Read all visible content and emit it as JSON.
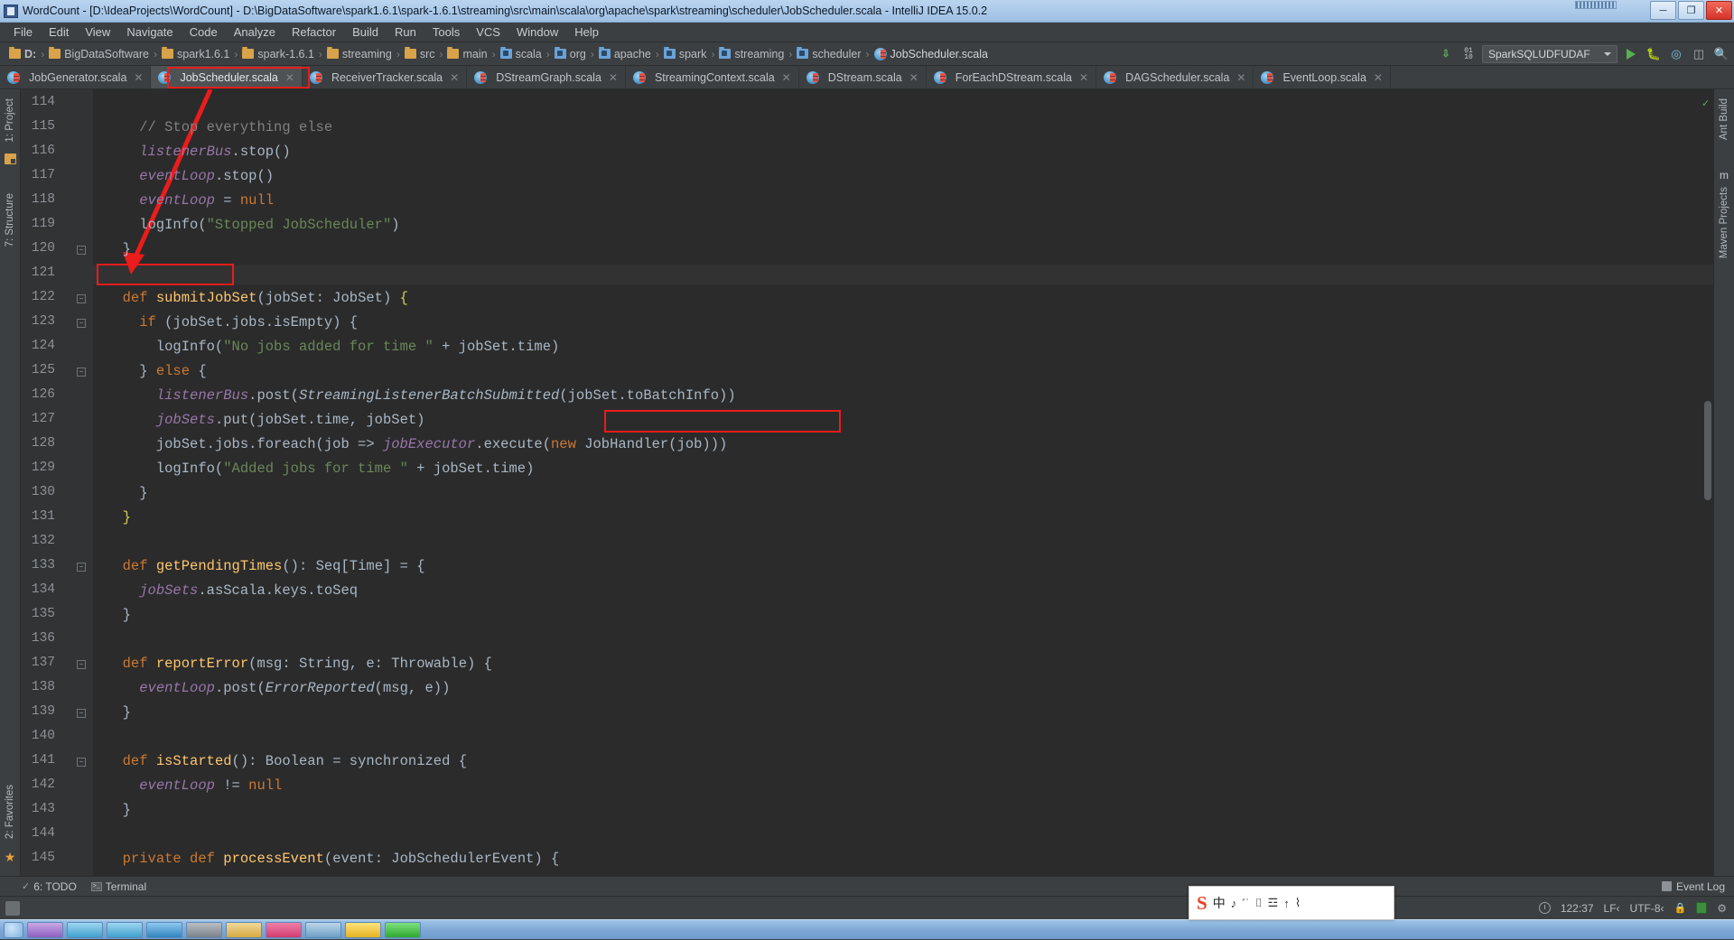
{
  "window": {
    "title": "WordCount - [D:\\IdeaProjects\\WordCount] - D:\\BigDataSoftware\\spark1.6.1\\spark-1.6.1\\streaming\\src\\main\\scala\\org\\apache\\spark\\streaming\\scheduler\\JobScheduler.scala - IntelliJ IDEA 15.0.2",
    "minimize": "─",
    "maximize": "❐",
    "close": "✕"
  },
  "menubar": {
    "items": [
      "File",
      "Edit",
      "View",
      "Navigate",
      "Code",
      "Analyze",
      "Refactor",
      "Build",
      "Run",
      "Tools",
      "VCS",
      "Window",
      "Help"
    ]
  },
  "breadcrumb": {
    "items": [
      {
        "label": "D:",
        "icon": "folder-icon",
        "type": "folder"
      },
      {
        "label": "BigDataSoftware",
        "icon": "folder-icon",
        "type": "folder"
      },
      {
        "label": "spark1.6.1",
        "icon": "folder-icon",
        "type": "folder"
      },
      {
        "label": "spark-1.6.1",
        "icon": "folder-icon",
        "type": "folder"
      },
      {
        "label": "streaming",
        "icon": "folder-icon",
        "type": "folder"
      },
      {
        "label": "src",
        "icon": "folder-icon",
        "type": "folder"
      },
      {
        "label": "main",
        "icon": "folder-icon",
        "type": "folder"
      },
      {
        "label": "scala",
        "icon": "package-icon",
        "type": "package"
      },
      {
        "label": "org",
        "icon": "package-icon",
        "type": "package"
      },
      {
        "label": "apache",
        "icon": "package-icon",
        "type": "package"
      },
      {
        "label": "spark",
        "icon": "package-icon",
        "type": "package"
      },
      {
        "label": "streaming",
        "icon": "package-icon",
        "type": "package"
      },
      {
        "label": "scheduler",
        "icon": "package-icon",
        "type": "package"
      },
      {
        "label": "JobScheduler.scala",
        "icon": "scala-file-icon",
        "type": "scala"
      }
    ]
  },
  "toolbar": {
    "run_config": "SparkSQLUDFUDAF",
    "sort_icon": "sort-descending-icon",
    "binary_icon": "binary-toggle-icon",
    "run_icon": "run-icon",
    "debug_icon": "debug-icon",
    "coverage_icon": "coverage-icon",
    "layout_icon": "layout-icon",
    "search_icon": "search-icon"
  },
  "editor_tabs": [
    {
      "label": "JobGenerator.scala",
      "selected": false,
      "close": "✕"
    },
    {
      "label": "JobScheduler.scala",
      "selected": true,
      "close": "✕"
    },
    {
      "label": "ReceiverTracker.scala",
      "selected": false,
      "close": "✕"
    },
    {
      "label": "DStreamGraph.scala",
      "selected": false,
      "close": "✕"
    },
    {
      "label": "StreamingContext.scala",
      "selected": false,
      "close": "✕"
    },
    {
      "label": "DStream.scala",
      "selected": false,
      "close": "✕"
    },
    {
      "label": "ForEachDStream.scala",
      "selected": false,
      "close": "✕"
    },
    {
      "label": "DAGScheduler.scala",
      "selected": false,
      "close": "✕"
    },
    {
      "label": "EventLoop.scala",
      "selected": false,
      "close": "✕"
    }
  ],
  "left_sidebar": {
    "items": [
      {
        "label": "1: Project",
        "icon": "project-icon"
      },
      {
        "label": "7: Structure",
        "icon": "structure-icon"
      },
      {
        "label": "2: Favorites",
        "icon": "favorites-star-icon"
      }
    ]
  },
  "right_sidebar": {
    "items": [
      {
        "label": "Ant Build",
        "icon": "ant-icon"
      },
      {
        "label": "Maven Projects",
        "icon": "maven-icon"
      }
    ]
  },
  "code": {
    "first_line": 114,
    "lines": [
      {
        "n": 114,
        "fold": "",
        "tokens": []
      },
      {
        "n": 115,
        "fold": "",
        "tokens": [
          {
            "t": "    ",
            "c": "plain"
          },
          {
            "t": "// Stop everything else",
            "c": "cmt"
          }
        ]
      },
      {
        "n": 116,
        "fold": "",
        "tokens": [
          {
            "t": "    ",
            "c": "plain"
          },
          {
            "t": "listenerBus",
            "c": "fld"
          },
          {
            "t": ".stop()",
            "c": "plain"
          }
        ]
      },
      {
        "n": 117,
        "fold": "",
        "tokens": [
          {
            "t": "    ",
            "c": "plain"
          },
          {
            "t": "eventLoop",
            "c": "fld"
          },
          {
            "t": ".stop()",
            "c": "plain"
          }
        ]
      },
      {
        "n": 118,
        "fold": "",
        "tokens": [
          {
            "t": "    ",
            "c": "plain"
          },
          {
            "t": "eventLoop",
            "c": "fld"
          },
          {
            "t": " = ",
            "c": "plain"
          },
          {
            "t": "null",
            "c": "kw"
          }
        ]
      },
      {
        "n": 119,
        "fold": "",
        "tokens": [
          {
            "t": "    logInfo(",
            "c": "plain"
          },
          {
            "t": "\"Stopped JobScheduler\"",
            "c": "str"
          },
          {
            "t": ")",
            "c": "plain"
          }
        ]
      },
      {
        "n": 120,
        "fold": "minus",
        "tokens": [
          {
            "t": "  }",
            "c": "plain"
          }
        ]
      },
      {
        "n": 121,
        "fold": "",
        "tokens": []
      },
      {
        "n": 122,
        "fold": "minus",
        "tokens": [
          {
            "t": "  ",
            "c": "plain"
          },
          {
            "t": "def",
            "c": "kw"
          },
          {
            "t": " ",
            "c": "plain"
          },
          {
            "t": "submitJobSet",
            "c": "mth"
          },
          {
            "t": "(jobSet: JobSet) ",
            "c": "plain"
          },
          {
            "t": "{",
            "c": "brc"
          }
        ]
      },
      {
        "n": 123,
        "fold": "minus",
        "tokens": [
          {
            "t": "    ",
            "c": "plain"
          },
          {
            "t": "if",
            "c": "kw"
          },
          {
            "t": " (jobSet.jobs.isEmpty) {",
            "c": "plain"
          }
        ]
      },
      {
        "n": 124,
        "fold": "",
        "tokens": [
          {
            "t": "      logInfo(",
            "c": "plain"
          },
          {
            "t": "\"No jobs added for time \"",
            "c": "str"
          },
          {
            "t": " + jobSet.time)",
            "c": "plain"
          }
        ]
      },
      {
        "n": 125,
        "fold": "minus",
        "tokens": [
          {
            "t": "    } ",
            "c": "plain"
          },
          {
            "t": "else",
            "c": "kw"
          },
          {
            "t": " {",
            "c": "plain"
          }
        ]
      },
      {
        "n": 126,
        "fold": "",
        "tokens": [
          {
            "t": "      ",
            "c": "plain"
          },
          {
            "t": "listenerBus",
            "c": "fld"
          },
          {
            "t": ".post(",
            "c": "plain"
          },
          {
            "t": "StreamingListenerBatchSubmitted",
            "c": "ital"
          },
          {
            "t": "(jobSet.toBatchInfo))",
            "c": "plain"
          }
        ]
      },
      {
        "n": 127,
        "fold": "",
        "tokens": [
          {
            "t": "      ",
            "c": "plain"
          },
          {
            "t": "jobSets",
            "c": "fld"
          },
          {
            "t": ".put(jobSet.time, jobSet)",
            "c": "plain"
          }
        ]
      },
      {
        "n": 128,
        "fold": "",
        "tokens": [
          {
            "t": "      jobSet.jobs.foreach(job => ",
            "c": "plain"
          },
          {
            "t": "jobExecutor",
            "c": "fld"
          },
          {
            "t": ".execute(",
            "c": "plain"
          },
          {
            "t": "new",
            "c": "kw"
          },
          {
            "t": " JobHandler(job)))",
            "c": "plain"
          }
        ]
      },
      {
        "n": 129,
        "fold": "",
        "tokens": [
          {
            "t": "      logInfo(",
            "c": "plain"
          },
          {
            "t": "\"Added jobs for time \"",
            "c": "str"
          },
          {
            "t": " + jobSet.time)",
            "c": "plain"
          }
        ]
      },
      {
        "n": 130,
        "fold": "",
        "tokens": [
          {
            "t": "    }",
            "c": "plain"
          }
        ]
      },
      {
        "n": 131,
        "fold": "",
        "tokens": [
          {
            "t": "  }",
            "c": "brc"
          }
        ]
      },
      {
        "n": 132,
        "fold": "",
        "tokens": []
      },
      {
        "n": 133,
        "fold": "minus",
        "tokens": [
          {
            "t": "  ",
            "c": "plain"
          },
          {
            "t": "def",
            "c": "kw"
          },
          {
            "t": " ",
            "c": "plain"
          },
          {
            "t": "getPendingTimes",
            "c": "mth"
          },
          {
            "t": "(): ",
            "c": "plain"
          },
          {
            "t": "Seq[Time]",
            "c": "typ2"
          },
          {
            "t": " = {",
            "c": "plain"
          }
        ]
      },
      {
        "n": 134,
        "fold": "",
        "tokens": [
          {
            "t": "    ",
            "c": "plain"
          },
          {
            "t": "jobSets",
            "c": "fld"
          },
          {
            "t": ".asScala.keys.toSeq",
            "c": "plain"
          }
        ]
      },
      {
        "n": 135,
        "fold": "",
        "tokens": [
          {
            "t": "  }",
            "c": "plain"
          }
        ]
      },
      {
        "n": 136,
        "fold": "",
        "tokens": []
      },
      {
        "n": 137,
        "fold": "minus",
        "tokens": [
          {
            "t": "  ",
            "c": "plain"
          },
          {
            "t": "def",
            "c": "kw"
          },
          {
            "t": " ",
            "c": "plain"
          },
          {
            "t": "reportError",
            "c": "mth"
          },
          {
            "t": "(msg: ",
            "c": "plain"
          },
          {
            "t": "String",
            "c": "typ2"
          },
          {
            "t": ", e: ",
            "c": "plain"
          },
          {
            "t": "Throwable",
            "c": "typ2"
          },
          {
            "t": ") {",
            "c": "plain"
          }
        ]
      },
      {
        "n": 138,
        "fold": "",
        "tokens": [
          {
            "t": "    ",
            "c": "plain"
          },
          {
            "t": "eventLoop",
            "c": "fld"
          },
          {
            "t": ".post(",
            "c": "plain"
          },
          {
            "t": "ErrorReported",
            "c": "ital"
          },
          {
            "t": "(msg, e))",
            "c": "plain"
          }
        ]
      },
      {
        "n": 139,
        "fold": "minus",
        "tokens": [
          {
            "t": "  }",
            "c": "plain"
          }
        ]
      },
      {
        "n": 140,
        "fold": "",
        "tokens": []
      },
      {
        "n": 141,
        "fold": "minus",
        "tokens": [
          {
            "t": "  ",
            "c": "plain"
          },
          {
            "t": "def",
            "c": "kw"
          },
          {
            "t": " ",
            "c": "plain"
          },
          {
            "t": "isStarted",
            "c": "mth"
          },
          {
            "t": "(): ",
            "c": "plain"
          },
          {
            "t": "Boolean",
            "c": "typ2"
          },
          {
            "t": " = synchronized {",
            "c": "plain"
          }
        ]
      },
      {
        "n": 142,
        "fold": "",
        "tokens": [
          {
            "t": "    ",
            "c": "plain"
          },
          {
            "t": "eventLoop",
            "c": "fld"
          },
          {
            "t": " != ",
            "c": "plain"
          },
          {
            "t": "null",
            "c": "kw"
          }
        ]
      },
      {
        "n": 143,
        "fold": "",
        "tokens": [
          {
            "t": "  }",
            "c": "plain"
          }
        ]
      },
      {
        "n": 144,
        "fold": "",
        "tokens": []
      },
      {
        "n": 145,
        "fold": "",
        "tokens": [
          {
            "t": "  ",
            "c": "plain"
          },
          {
            "t": "private",
            "c": "kw"
          },
          {
            "t": " ",
            "c": "plain"
          },
          {
            "t": "def",
            "c": "kw"
          },
          {
            "t": " ",
            "c": "plain"
          },
          {
            "t": "processEvent",
            "c": "mth"
          },
          {
            "t": "(event: JobSchedulerEvent) {",
            "c": "plain"
          }
        ]
      }
    ],
    "annotations": {
      "highlight_color": "#ea1c1c",
      "boxes": [
        "tab-JobScheduler.scala",
        "submitJobSet",
        "new JobHandler(job)))"
      ],
      "arrow_from_tab_to_method": true
    }
  },
  "bottom_bar": {
    "todo": "6: TODO",
    "terminal": "Terminal",
    "event_log": "Event Log"
  },
  "statusbar": {
    "position": "122:37",
    "line_separator": "LF‹",
    "encoding": "UTF-8‹",
    "lock_icon": "lock-icon",
    "clock_icon": "clock-icon",
    "memory_icon": "memory-indicator-icon",
    "gear_icon": "gear-icon"
  },
  "ime_bar": {
    "logo": "S",
    "mode": "中",
    "glyphs": [
      "♪",
      "´˙",
      "⌷",
      "☲",
      "↑",
      "⌇"
    ]
  }
}
